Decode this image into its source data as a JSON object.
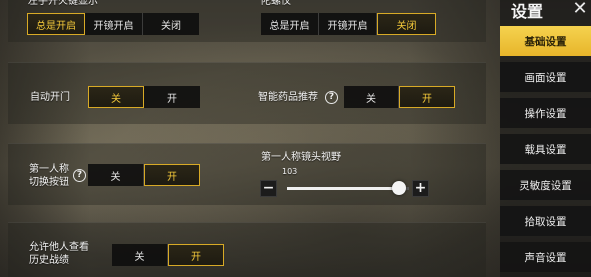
{
  "section_top": {
    "left_label": "左手开火键显示",
    "left_options": [
      "总是开启",
      "开镜开启",
      "关闭"
    ],
    "left_selected": 0,
    "right_label": "陀螺仪",
    "right_options": [
      "总是开启",
      "开镜开启",
      "关闭"
    ],
    "right_selected": 2
  },
  "row_auto_door": {
    "label": "自动开门",
    "options": [
      "关",
      "开"
    ],
    "selected": 0
  },
  "row_smart_meds": {
    "label": "智能药品推荐",
    "options": [
      "关",
      "开"
    ],
    "selected": 1,
    "help": "?"
  },
  "row_fpp_button": {
    "label_line1": "第一人称",
    "label_line2": "切换按钮",
    "options": [
      "关",
      "开"
    ],
    "selected": 1,
    "help": "?"
  },
  "row_fpp_fov": {
    "label": "第一人称镜头视野",
    "value": "103",
    "value_fraction": 0.92,
    "minus": "−",
    "plus": "+"
  },
  "row_history": {
    "label_line1": "允许他人查看",
    "label_line2": "历史战绩",
    "options": [
      "关",
      "开"
    ],
    "selected": 1
  },
  "sidebar": {
    "title": "设置",
    "close": "✕",
    "items": [
      "基础设置",
      "画面设置",
      "操作设置",
      "载具设置",
      "灵敏度设置",
      "拾取设置",
      "声音设置"
    ],
    "active": 0
  },
  "colors": {
    "accent": "#f4c93a",
    "accent_border": "#d8aa26",
    "sidebar_active": "#efc23c"
  }
}
